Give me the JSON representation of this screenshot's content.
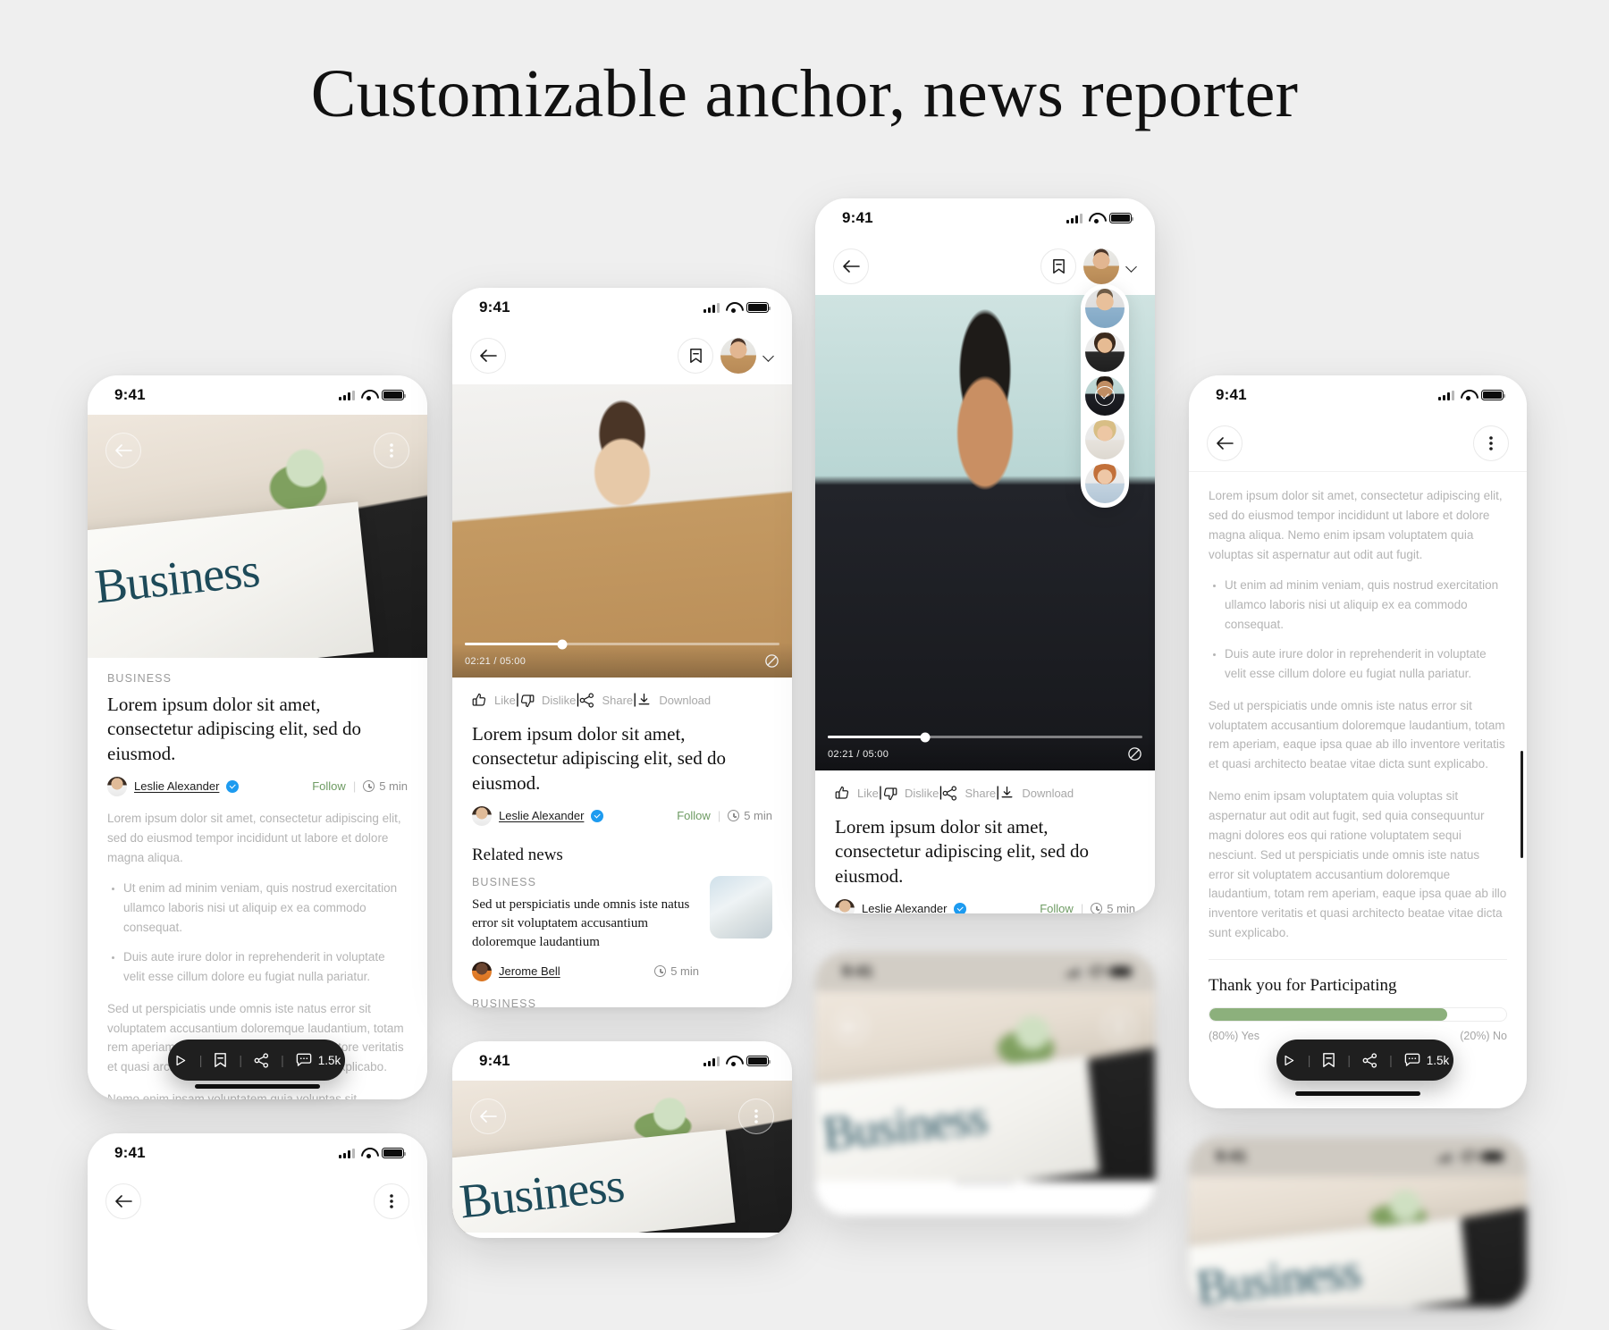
{
  "page": {
    "title": "Customizable anchor, news reporter"
  },
  "status_bar": {
    "time": "9:41",
    "signal_icon": "cellular-signal-icon",
    "wifi_icon": "wifi-icon",
    "battery_icon": "battery-icon"
  },
  "icons": {
    "back": "back-arrow-icon",
    "bookmark": "bookmark-icon",
    "chevron_down": "chevron-down-icon",
    "more": "more-vertical-icon",
    "play": "play-icon",
    "share": "share-icon",
    "comment": "comment-icon",
    "like": "thumbs-up-icon",
    "dislike": "thumbs-down-icon",
    "download": "download-icon",
    "loop": "loop-icon",
    "clock": "clock-icon",
    "verified": "verified-badge-icon",
    "check": "check-icon"
  },
  "article": {
    "kicker": "BUSINESS",
    "headline": "Lorem ipsum dolor sit amet, consectetur adipiscing elit, sed do eiusmod.",
    "author": "Leslie Alexander",
    "follow_label": "Follow",
    "read_time": "5 min",
    "paragraph_1": "Lorem ipsum dolor sit amet, consectetur adipiscing elit, sed do eiusmod tempor incididunt ut labore et dolore magna aliqua.",
    "bullet_1": "Ut enim ad minim veniam, quis nostrud exercitation ullamco laboris nisi ut aliquip ex ea commodo consequat.",
    "bullet_2": "Duis aute irure dolor in reprehenderit in voluptate velit esse cillum dolore eu fugiat nulla pariatur.",
    "paragraph_2": "Sed ut perspiciatis unde omnis iste natus error sit voluptatem accusantium doloremque laudantium, totam rem aperiam, eaque ipsa quae ab illo inventore veritatis et quasi architecto beatae vitae dicta sunt explicabo.",
    "paragraph_3": "Nemo enim ipsam voluptatem quia voluptas sit aspernatur aut odit aut fugit, sed quia consequuntur magni dolores eos qui ratione voluptatem sequi nesciunt."
  },
  "article_long": {
    "paragraph_1": "Lorem ipsum dolor sit amet, consectetur adipiscing elit, sed do eiusmod tempor incididunt ut labore et dolore magna aliqua. Nemo enim ipsam voluptatem quia voluptas sit aspernatur aut odit aut fugit.",
    "bullet_1": "Ut enim ad minim veniam, quis nostrud exercitation ullamco laboris nisi ut aliquip ex ea commodo consequat.",
    "bullet_2": "Duis aute irure dolor in reprehenderit in voluptate velit esse cillum dolore eu fugiat nulla pariatur.",
    "paragraph_2": "Sed ut perspiciatis unde omnis iste natus error sit voluptatem accusantium doloremque laudantium, totam rem aperiam, eaque ipsa quae ab illo inventore veritatis et quasi architecto beatae vitae dicta sunt explicabo.",
    "paragraph_3": "Nemo enim ipsam voluptatem quia voluptas sit aspernatur aut odit aut fugit, sed quia consequuntur magni dolores eos qui ratione voluptatem sequi nesciunt. Sed ut perspiciatis unde omnis iste natus error sit voluptatem accusantium doloremque laudantium, totam rem aperiam, eaque ipsa quae ab illo inventore veritatis et quasi architecto beatae vitae dicta sunt explicabo."
  },
  "player": {
    "time_elapsed_total": "02:21 / 05:00",
    "progress_percent": 31
  },
  "video_actions": {
    "like": "Like",
    "dislike": "Dislike",
    "share": "Share",
    "download": "Download"
  },
  "floating_pill": {
    "comment_count": "1.5k"
  },
  "related": {
    "section_title": "Related news",
    "kicker": "BUSINESS",
    "headline": "Sed ut perspiciatis unde omnis iste natus error sit voluptatem accusantium doloremque laudantium",
    "author": "Jerome Bell",
    "read_time": "5 min",
    "kicker_next": "BUSINESS"
  },
  "poll": {
    "title": "Thank you for Participating",
    "yes_label": "(80%) Yes",
    "no_label": "(20%) No",
    "yes_percent": 80,
    "no_percent": 20,
    "bar_color": "#8cb07c"
  },
  "avatar_rail": {
    "selected_index": 2,
    "items": [
      {
        "name": "avatar-blue-shirt"
      },
      {
        "name": "avatar-curly-hair-woman"
      },
      {
        "name": "avatar-suit-man-selected"
      },
      {
        "name": "avatar-blonde-woman"
      },
      {
        "name": "avatar-red-hair-woman"
      }
    ]
  },
  "colors": {
    "accent_follow": "#6e9b63",
    "verified_blue": "#1d9bf0",
    "pill_dark": "#1f1f1f",
    "page_bg": "#efefef"
  }
}
